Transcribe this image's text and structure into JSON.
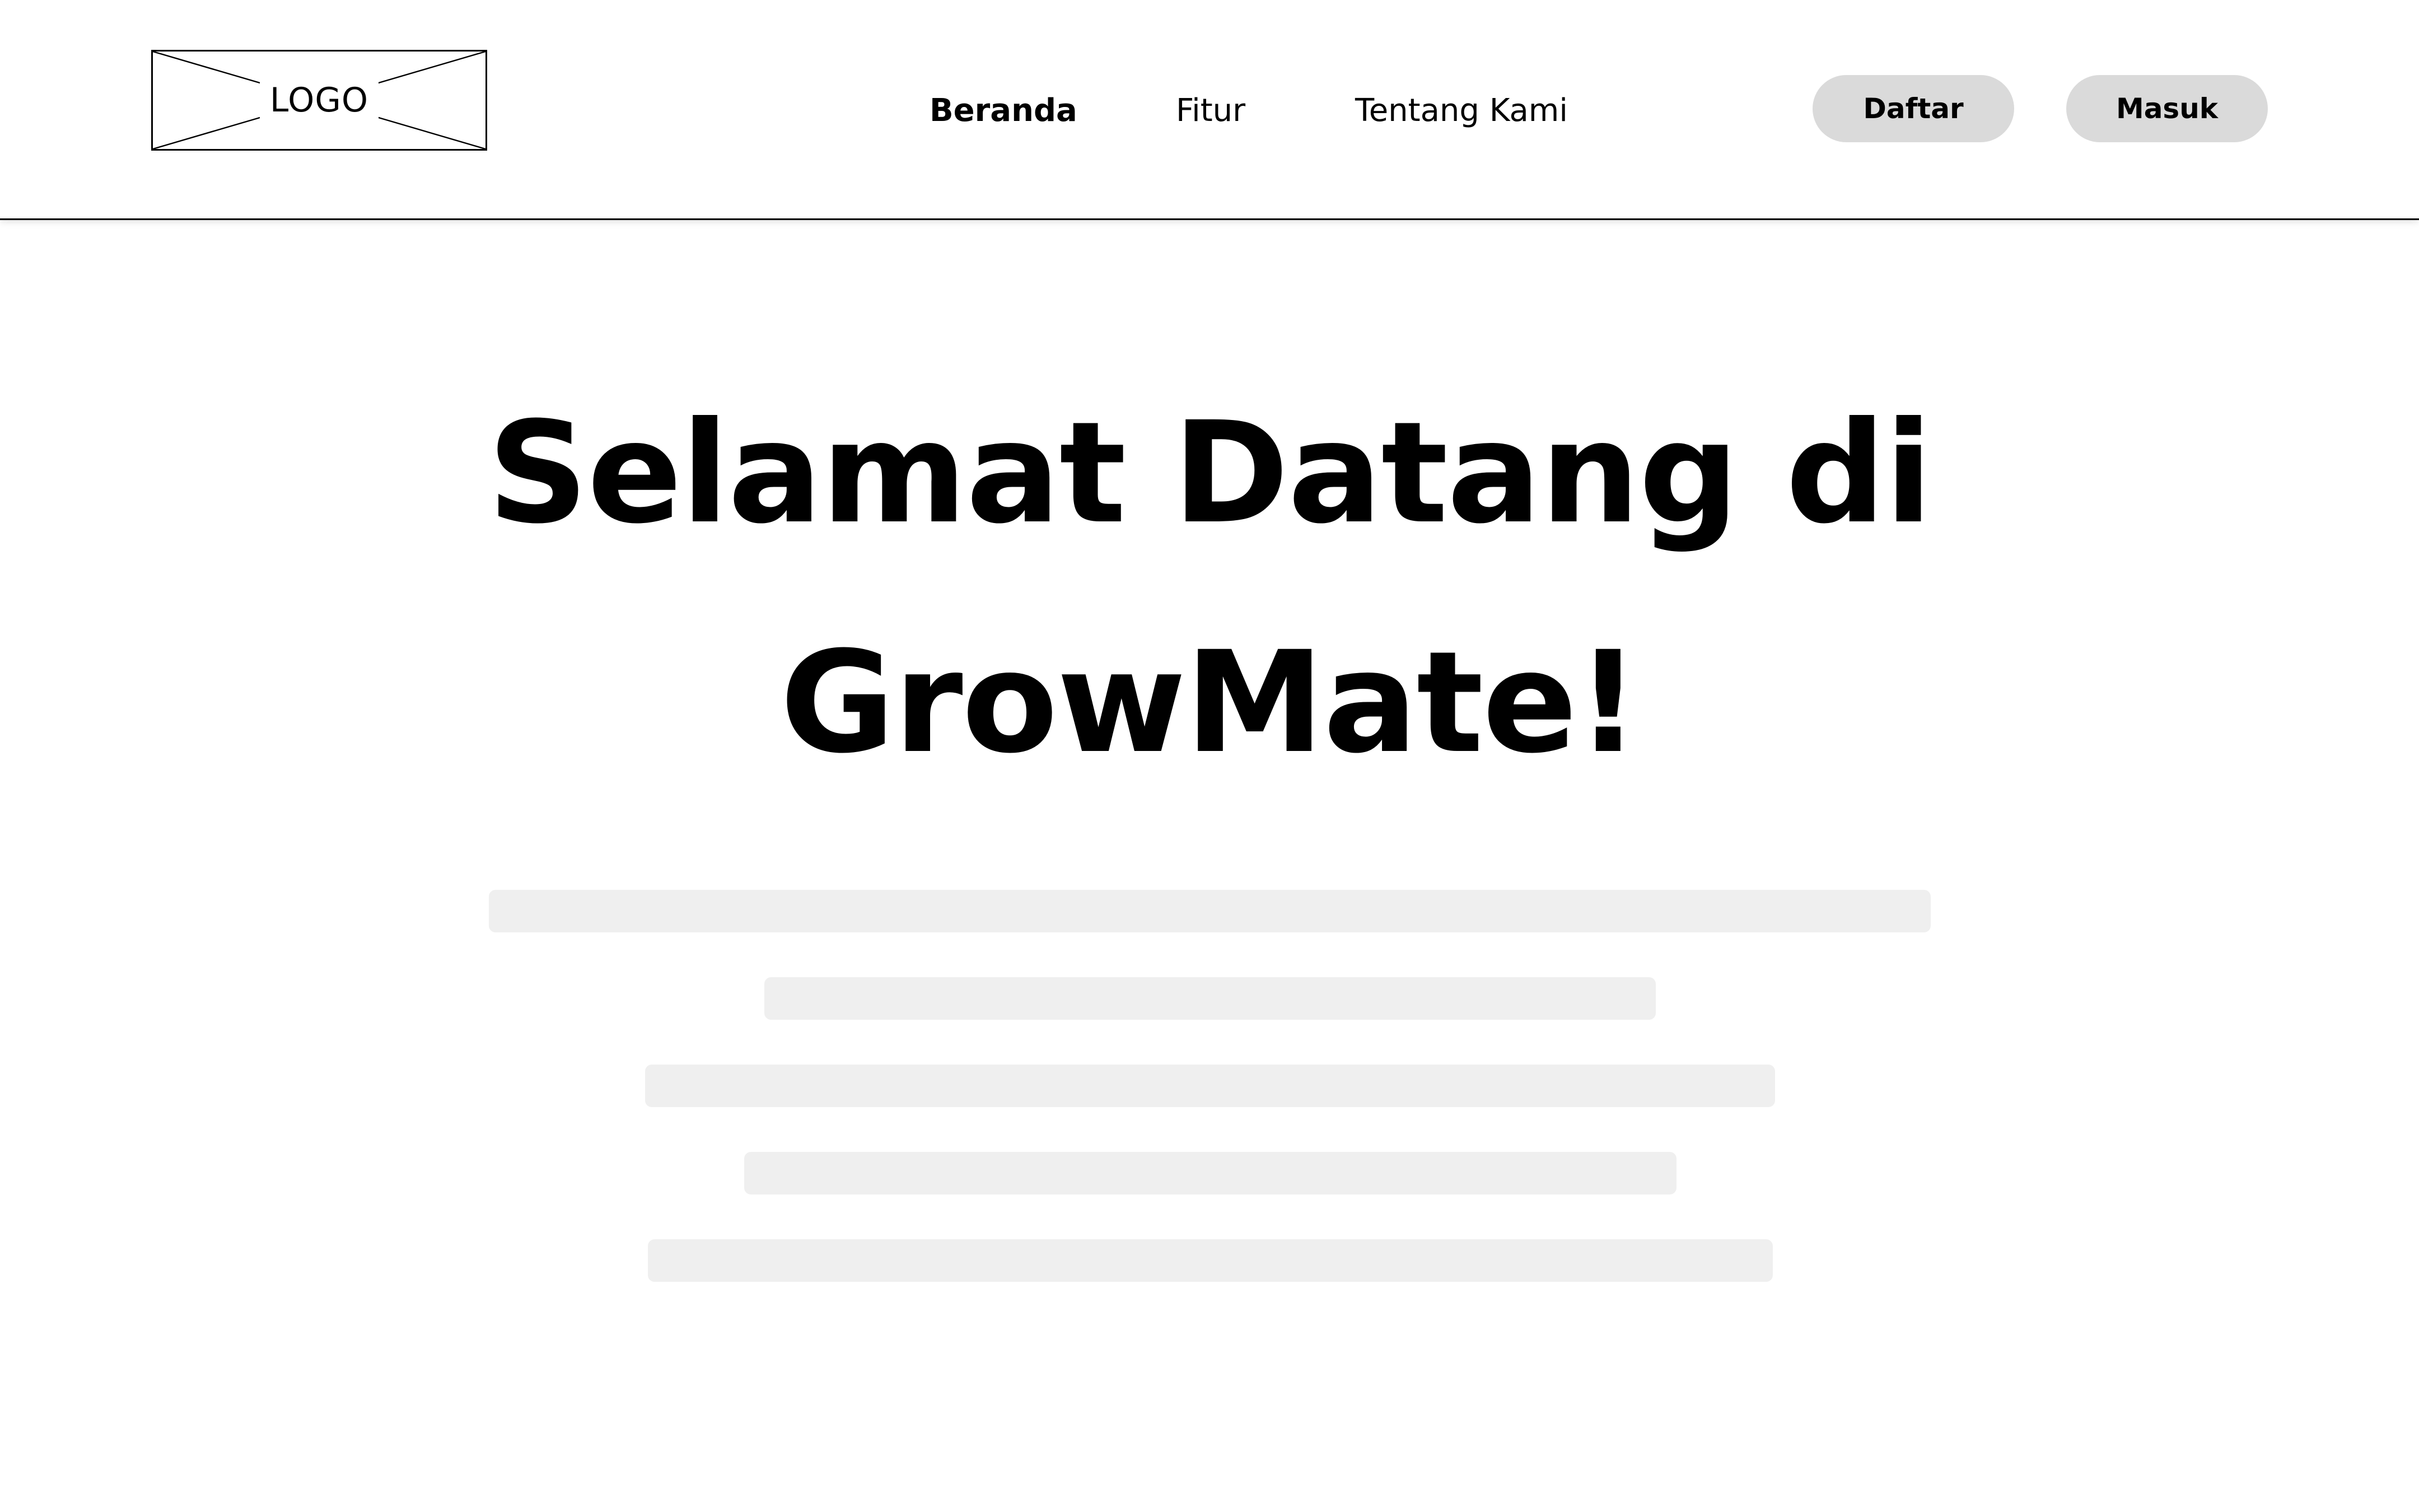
{
  "header": {
    "logo_text": "LOGO",
    "nav": [
      {
        "label": "Beranda",
        "active": true
      },
      {
        "label": "Fitur",
        "active": false
      },
      {
        "label": "Tentang Kami",
        "active": false
      }
    ],
    "buttons": {
      "register_label": "Daftar",
      "login_label": "Masuk"
    }
  },
  "hero": {
    "title_line_1": "Selamat Datang di",
    "title_line_2": "GrowMate!"
  },
  "theme": {
    "button_background": "#dadada",
    "placeholder_color": "#efefef",
    "text_color": "#000000",
    "page_background": "#ffffff"
  }
}
